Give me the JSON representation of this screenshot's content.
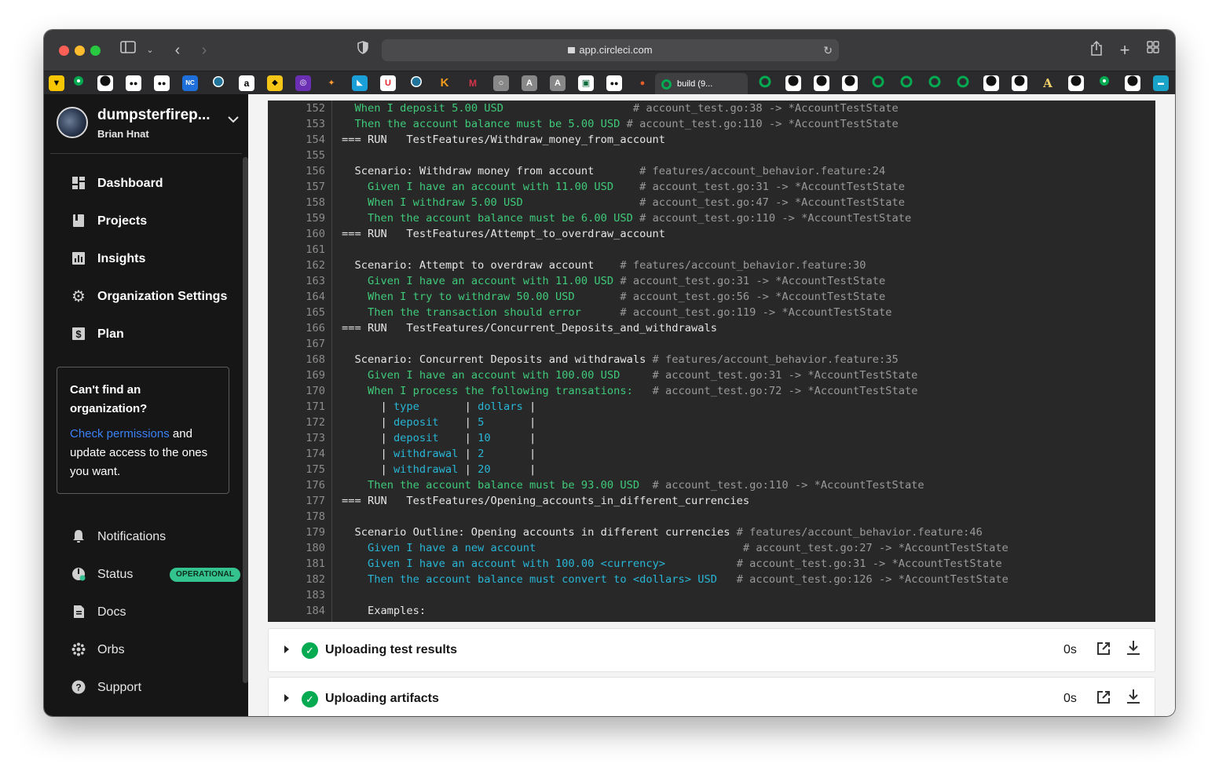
{
  "browser": {
    "url": "app.circleci.com",
    "active_tab_title": "build (9..."
  },
  "sidebar": {
    "org_name": "dumpsterfirep...",
    "user_name": "Brian Hnat",
    "nav": [
      {
        "label": "Dashboard",
        "icon": "dashboard-icon"
      },
      {
        "label": "Projects",
        "icon": "projects-icon"
      },
      {
        "label": "Insights",
        "icon": "insights-icon"
      },
      {
        "label": "Organization Settings",
        "icon": "gear-icon"
      },
      {
        "label": "Plan",
        "icon": "dollar-icon"
      }
    ],
    "org_box": {
      "question": "Can't find an organization?",
      "link": "Check permissions",
      "rest": " and update access to the ones you want."
    },
    "bottom_nav": [
      {
        "label": "Notifications",
        "icon": "bell-icon"
      },
      {
        "label": "Status",
        "icon": "status-icon",
        "badge": "OPERATIONAL"
      },
      {
        "label": "Docs",
        "icon": "docs-icon"
      },
      {
        "label": "Orbs",
        "icon": "orbs-icon"
      },
      {
        "label": "Support",
        "icon": "help-icon"
      }
    ]
  },
  "console": {
    "lines": [
      {
        "n": "152",
        "segs": [
          [
            "  ",
            "w"
          ],
          [
            "When I deposit 5.00 USD",
            "g"
          ],
          [
            "                    # account_test.go:38 -> *AccountTestState",
            "x"
          ]
        ]
      },
      {
        "n": "153",
        "segs": [
          [
            "  ",
            "w"
          ],
          [
            "Then the account balance must be 5.00 USD",
            "g"
          ],
          [
            " # account_test.go:110 -> *AccountTestState",
            "x"
          ]
        ]
      },
      {
        "n": "154",
        "segs": [
          [
            "=== RUN   TestFeatures/Withdraw_money_from_account",
            "w"
          ]
        ]
      },
      {
        "n": "155",
        "segs": []
      },
      {
        "n": "156",
        "segs": [
          [
            "  Scenario: Withdraw money from account",
            "w"
          ],
          [
            "       # features/account_behavior.feature:24",
            "x"
          ]
        ]
      },
      {
        "n": "157",
        "segs": [
          [
            "    ",
            "w"
          ],
          [
            "Given I have an account with 11.00 USD",
            "g"
          ],
          [
            "    # account_test.go:31 -> *AccountTestState",
            "x"
          ]
        ]
      },
      {
        "n": "158",
        "segs": [
          [
            "    ",
            "w"
          ],
          [
            "When I withdraw 5.00 USD",
            "g"
          ],
          [
            "                  # account_test.go:47 -> *AccountTestState",
            "x"
          ]
        ]
      },
      {
        "n": "159",
        "segs": [
          [
            "    ",
            "w"
          ],
          [
            "Then the account balance must be 6.00 USD",
            "g"
          ],
          [
            " # account_test.go:110 -> *AccountTestState",
            "x"
          ]
        ]
      },
      {
        "n": "160",
        "segs": [
          [
            "=== RUN   TestFeatures/Attempt_to_overdraw_account",
            "w"
          ]
        ]
      },
      {
        "n": "161",
        "segs": []
      },
      {
        "n": "162",
        "segs": [
          [
            "  Scenario: Attempt to overdraw account",
            "w"
          ],
          [
            "    # features/account_behavior.feature:30",
            "x"
          ]
        ]
      },
      {
        "n": "163",
        "segs": [
          [
            "    ",
            "w"
          ],
          [
            "Given I have an account with 11.00 USD",
            "g"
          ],
          [
            " # account_test.go:31 -> *AccountTestState",
            "x"
          ]
        ]
      },
      {
        "n": "164",
        "segs": [
          [
            "    ",
            "w"
          ],
          [
            "When I try to withdraw 50.00 USD",
            "g"
          ],
          [
            "       # account_test.go:56 -> *AccountTestState",
            "x"
          ]
        ]
      },
      {
        "n": "165",
        "segs": [
          [
            "    ",
            "w"
          ],
          [
            "Then the transaction should error",
            "g"
          ],
          [
            "      # account_test.go:119 -> *AccountTestState",
            "x"
          ]
        ]
      },
      {
        "n": "166",
        "segs": [
          [
            "=== RUN   TestFeatures/Concurrent_Deposits_and_withdrawals",
            "w"
          ]
        ]
      },
      {
        "n": "167",
        "segs": []
      },
      {
        "n": "168",
        "segs": [
          [
            "  Scenario: Concurrent Deposits and withdrawals",
            "w"
          ],
          [
            " # features/account_behavior.feature:35",
            "x"
          ]
        ]
      },
      {
        "n": "169",
        "segs": [
          [
            "    ",
            "w"
          ],
          [
            "Given I have an account with 100.00 USD",
            "g"
          ],
          [
            "     # account_test.go:31 -> *AccountTestState",
            "x"
          ]
        ]
      },
      {
        "n": "170",
        "segs": [
          [
            "    ",
            "w"
          ],
          [
            "When I process the following transations:",
            "g"
          ],
          [
            "   # account_test.go:72 -> *AccountTestState",
            "x"
          ]
        ]
      },
      {
        "n": "171",
        "segs": [
          [
            "      | ",
            "w"
          ],
          [
            "type",
            "c"
          ],
          [
            "       | ",
            "w"
          ],
          [
            "dollars",
            "c"
          ],
          [
            " |",
            "w"
          ]
        ]
      },
      {
        "n": "172",
        "segs": [
          [
            "      | ",
            "w"
          ],
          [
            "deposit",
            "c"
          ],
          [
            "    | ",
            "w"
          ],
          [
            "5",
            "c"
          ],
          [
            "       |",
            "w"
          ]
        ]
      },
      {
        "n": "173",
        "segs": [
          [
            "      | ",
            "w"
          ],
          [
            "deposit",
            "c"
          ],
          [
            "    | ",
            "w"
          ],
          [
            "10",
            "c"
          ],
          [
            "      |",
            "w"
          ]
        ]
      },
      {
        "n": "174",
        "segs": [
          [
            "      | ",
            "w"
          ],
          [
            "withdrawal",
            "c"
          ],
          [
            " | ",
            "w"
          ],
          [
            "2",
            "c"
          ],
          [
            "       |",
            "w"
          ]
        ]
      },
      {
        "n": "175",
        "segs": [
          [
            "      | ",
            "w"
          ],
          [
            "withdrawal",
            "c"
          ],
          [
            " | ",
            "w"
          ],
          [
            "20",
            "c"
          ],
          [
            "      |",
            "w"
          ]
        ]
      },
      {
        "n": "176",
        "segs": [
          [
            "    ",
            "w"
          ],
          [
            "Then the account balance must be 93.00 USD",
            "g"
          ],
          [
            "  # account_test.go:110 -> *AccountTestState",
            "x"
          ]
        ]
      },
      {
        "n": "177",
        "segs": [
          [
            "=== RUN   TestFeatures/Opening_accounts_in_different_currencies",
            "w"
          ]
        ]
      },
      {
        "n": "178",
        "segs": []
      },
      {
        "n": "179",
        "segs": [
          [
            "  Scenario Outline: Opening accounts in different currencies",
            "w"
          ],
          [
            " # features/account_behavior.feature:46",
            "x"
          ]
        ]
      },
      {
        "n": "180",
        "segs": [
          [
            "    ",
            "w"
          ],
          [
            "Given I have a new account",
            "c"
          ],
          [
            "                                # account_test.go:27 -> *AccountTestState",
            "x"
          ]
        ]
      },
      {
        "n": "181",
        "segs": [
          [
            "    ",
            "w"
          ],
          [
            "Given I have an account with 100.00 ",
            "c"
          ],
          [
            "<currency>",
            "c"
          ],
          [
            "           # account_test.go:31 -> *AccountTestState",
            "x"
          ]
        ]
      },
      {
        "n": "182",
        "segs": [
          [
            "    ",
            "w"
          ],
          [
            "Then the account balance must convert to ",
            "c"
          ],
          [
            "<dollars>",
            "c"
          ],
          [
            " USD",
            "c"
          ],
          [
            "   # account_test.go:126 -> *AccountTestState",
            "x"
          ]
        ]
      },
      {
        "n": "183",
        "segs": []
      },
      {
        "n": "184",
        "segs": [
          [
            "    Examples:",
            "w"
          ]
        ]
      }
    ]
  },
  "steps": [
    {
      "title": "Uploading test results",
      "duration": "0s"
    },
    {
      "title": "Uploading artifacts",
      "duration": "0s"
    }
  ],
  "colors": {
    "circleci_green": "#04aa51",
    "status_badge": "#34c38f",
    "link_blue": "#3b82f6"
  }
}
